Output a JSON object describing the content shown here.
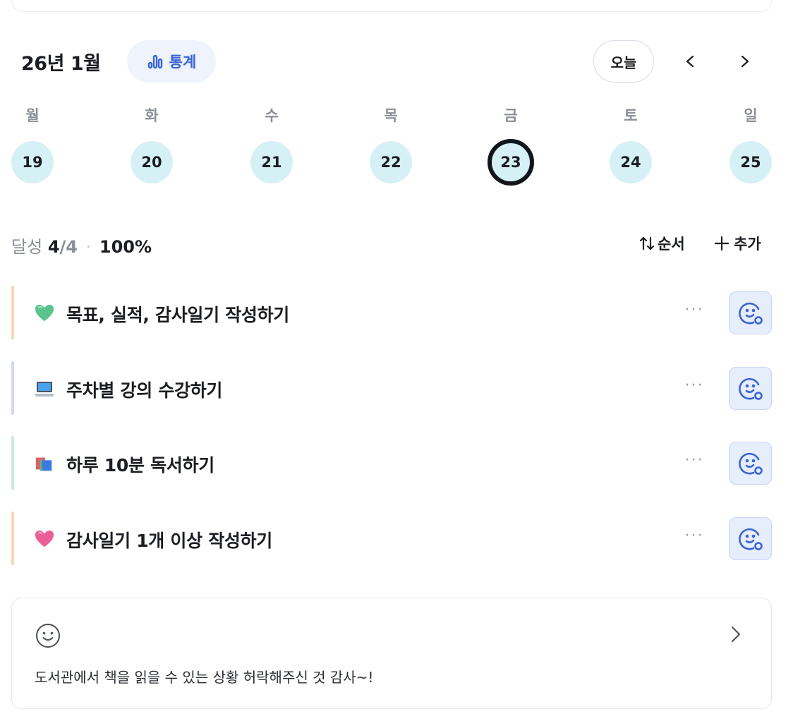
{
  "header": {
    "month_title": "26년 1월",
    "stats_label": "통계",
    "today_label": "오늘"
  },
  "week": {
    "weekdays": [
      "월",
      "화",
      "수",
      "목",
      "금",
      "토",
      "일"
    ],
    "days": [
      "19",
      "20",
      "21",
      "22",
      "23",
      "24",
      "25"
    ],
    "selected_day": "23"
  },
  "progress": {
    "label": "달성",
    "done": "4",
    "total": "/4",
    "separator": "·",
    "percent": "100%"
  },
  "actions": {
    "order_label": "순서",
    "add_label": "추가"
  },
  "habits": [
    {
      "icon": "green-heart-icon",
      "label": "목표, 실적, 감사일기 작성하기",
      "color": "#f9d7b3"
    },
    {
      "icon": "laptop-icon",
      "label": "주차별 강의 수강하기",
      "color": "#cfdaf5"
    },
    {
      "icon": "books-icon",
      "label": "하루 10분 독서하기",
      "color": "#c9ecd6"
    },
    {
      "icon": "pink-heart-icon",
      "label": "감사일기 1개 이상 작성하기",
      "color": "#f9d7b3"
    }
  ],
  "more_glyph": "···",
  "note": {
    "icon": "smile-icon",
    "text": "도서관에서 책을 읽을 수 있는 상황 허락해주신 것 감사~!"
  },
  "colors": {
    "accent": "#3a63d4",
    "day_bg": "#d6f1f5",
    "check_bg": "#e6edfb"
  }
}
